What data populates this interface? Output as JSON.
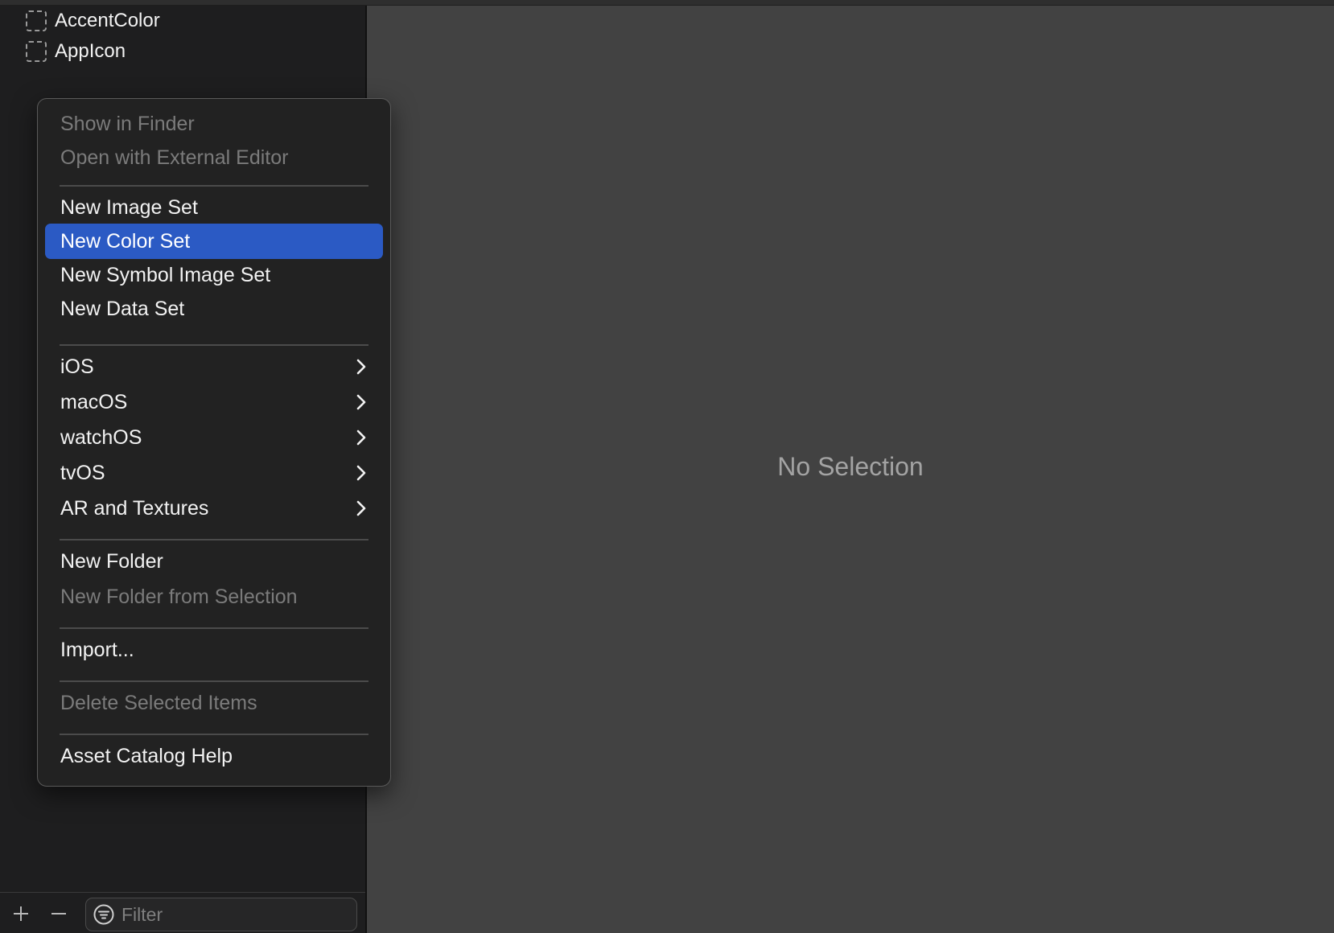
{
  "sidebar": {
    "assets": [
      {
        "label": "AccentColor"
      },
      {
        "label": "AppIcon"
      }
    ],
    "add_icon": "plus-icon",
    "remove_icon": "minus-icon",
    "filter": {
      "placeholder": "Filter",
      "value": "",
      "icon": "filter-icon"
    }
  },
  "main": {
    "empty_text": "No Selection"
  },
  "context_menu": {
    "show_in_finder": "Show in Finder",
    "open_external": "Open with External Editor",
    "new_image_set": "New Image Set",
    "new_color_set": "New Color Set",
    "new_symbol_image_set": "New Symbol Image Set",
    "new_data_set": "New Data Set",
    "ios": "iOS",
    "macos": "macOS",
    "watchos": "watchOS",
    "tvos": "tvOS",
    "ar_textures": "AR and Textures",
    "new_folder": "New Folder",
    "new_folder_from_selection": "New Folder from Selection",
    "import": "Import...",
    "delete_selected": "Delete Selected Items",
    "help": "Asset Catalog Help",
    "highlight_color": "#2b5ac4"
  }
}
